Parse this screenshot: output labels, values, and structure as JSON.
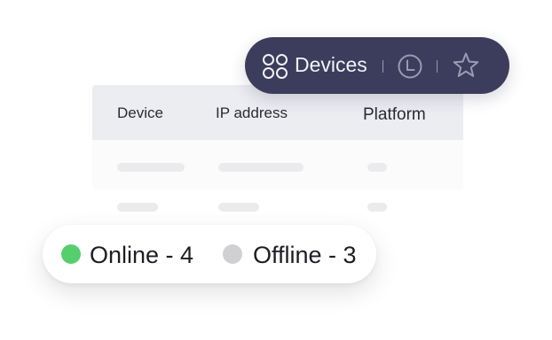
{
  "table": {
    "columns": [
      "Device",
      "IP address",
      "Platform"
    ]
  },
  "toolbar": {
    "devices_label": "Devices",
    "icons": {
      "devices": "grid-four-circles-icon",
      "history": "clock-icon",
      "favorites": "star-icon"
    }
  },
  "status": {
    "online_label": "Online - 4",
    "offline_label": "Offline - 3"
  },
  "colors": {
    "toolbar_bg": "#3c3c5c",
    "online": "#55cf6e",
    "offline": "#d0d0d3",
    "table_header_bg": "#ecedf1",
    "skeleton": "#ebebee"
  }
}
